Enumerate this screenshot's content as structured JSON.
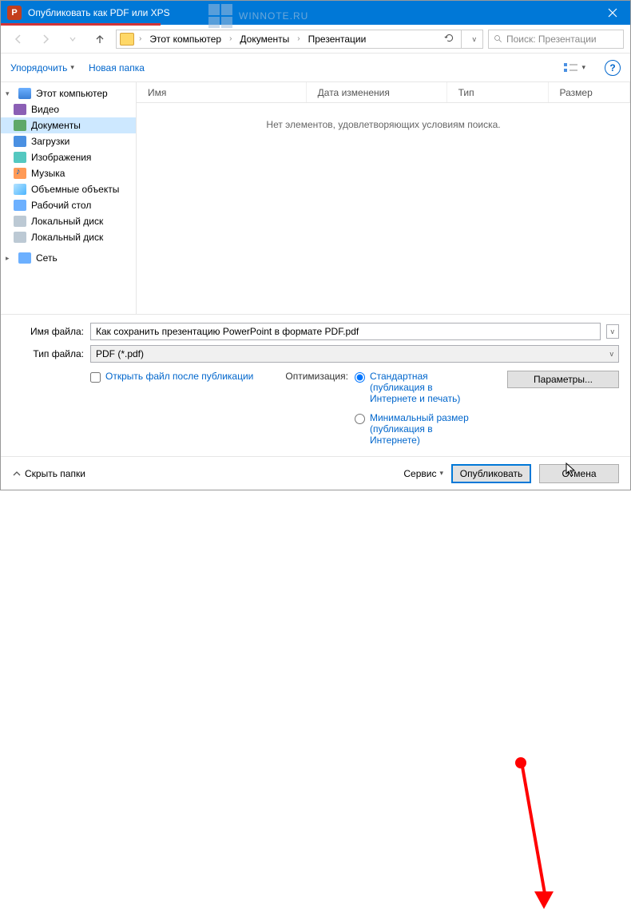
{
  "watermark": "WINNOTE.RU",
  "titlebar": {
    "title": "Опубликовать как PDF или XPS"
  },
  "nav": {
    "breadcrumb": {
      "pc": "Этот компьютер",
      "docs": "Документы",
      "pres": "Презентации"
    },
    "search_placeholder": "Поиск: Презентации"
  },
  "toolbar": {
    "organize": "Упорядочить",
    "newfolder": "Новая папка"
  },
  "tree": {
    "pc": "Этот компьютер",
    "video": "Видео",
    "docs": "Документы",
    "downloads": "Загрузки",
    "images": "Изображения",
    "music": "Музыка",
    "volumes": "Объемные объекты",
    "desktop": "Рабочий стол",
    "drive1": "Локальный диск",
    "drive2": "Локальный диск",
    "network": "Сеть"
  },
  "columns": {
    "name": "Имя",
    "date": "Дата изменения",
    "type": "Тип",
    "size": "Размер"
  },
  "empty": "Нет элементов, удовлетворяющих условиям поиска.",
  "fields": {
    "filename_lbl": "Имя файла:",
    "filename_val": "Как сохранить презентацию PowerPoint в формате PDF.pdf",
    "filetype_lbl": "Тип файла:",
    "filetype_val": "PDF (*.pdf)"
  },
  "options": {
    "open_after": "Открыть файл после публикации",
    "optimize_lbl": "Оптимизация:",
    "standard": "Стандартная (публикация в Интернете и печать)",
    "minimal": "Минимальный размер (публикация в Интернете)",
    "params": "Параметры..."
  },
  "footer": {
    "hide": "Скрыть папки",
    "service": "Сервис",
    "publish": "Опубликовать",
    "cancel": "Отмена"
  }
}
